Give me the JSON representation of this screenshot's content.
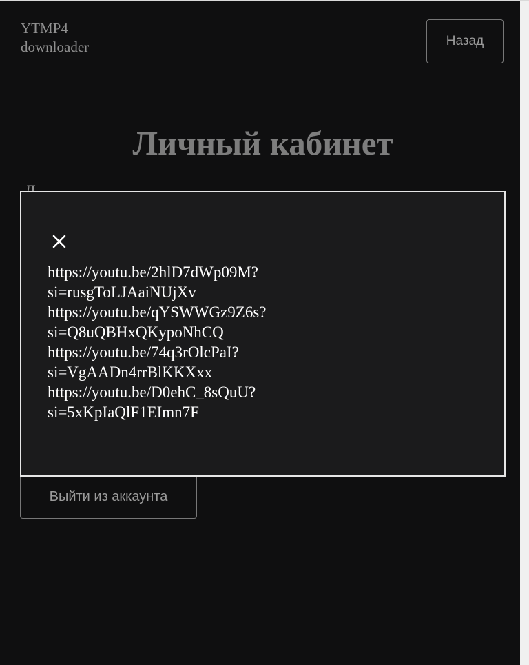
{
  "header": {
    "brand_line_1": "YTMP4",
    "brand_line_2": "downloader",
    "back_label": "Назад"
  },
  "main": {
    "title": "Личный кабинет",
    "partial_label": "Д",
    "logout_label": "Выйти из аккаунта"
  },
  "modal": {
    "close_icon": "close-icon",
    "links": [
      {
        "line_1": "https://youtu.be/2hlD7dWp09M?",
        "line_2": "si=rusgToLJAaiNUjXv"
      },
      {
        "line_1": "https://youtu.be/qYSWWGz9Z6s?",
        "line_2": "si=Q8uQBHxQKypoNhCQ"
      },
      {
        "line_1": "https://youtu.be/74q3rOlcPaI?",
        "line_2": "si=VgAADn4rrBlKKXxx"
      },
      {
        "line_1": "https://youtu.be/D0ehC_8sQuU?",
        "line_2": "si=5xKpIaQlF1EImn7F"
      }
    ]
  },
  "colors": {
    "background": "#0f0f10",
    "modal_background": "#1b1b1c",
    "modal_border": "#e6e6e6",
    "muted_text": "#8f8f8f",
    "link_text": "#ffffff"
  }
}
